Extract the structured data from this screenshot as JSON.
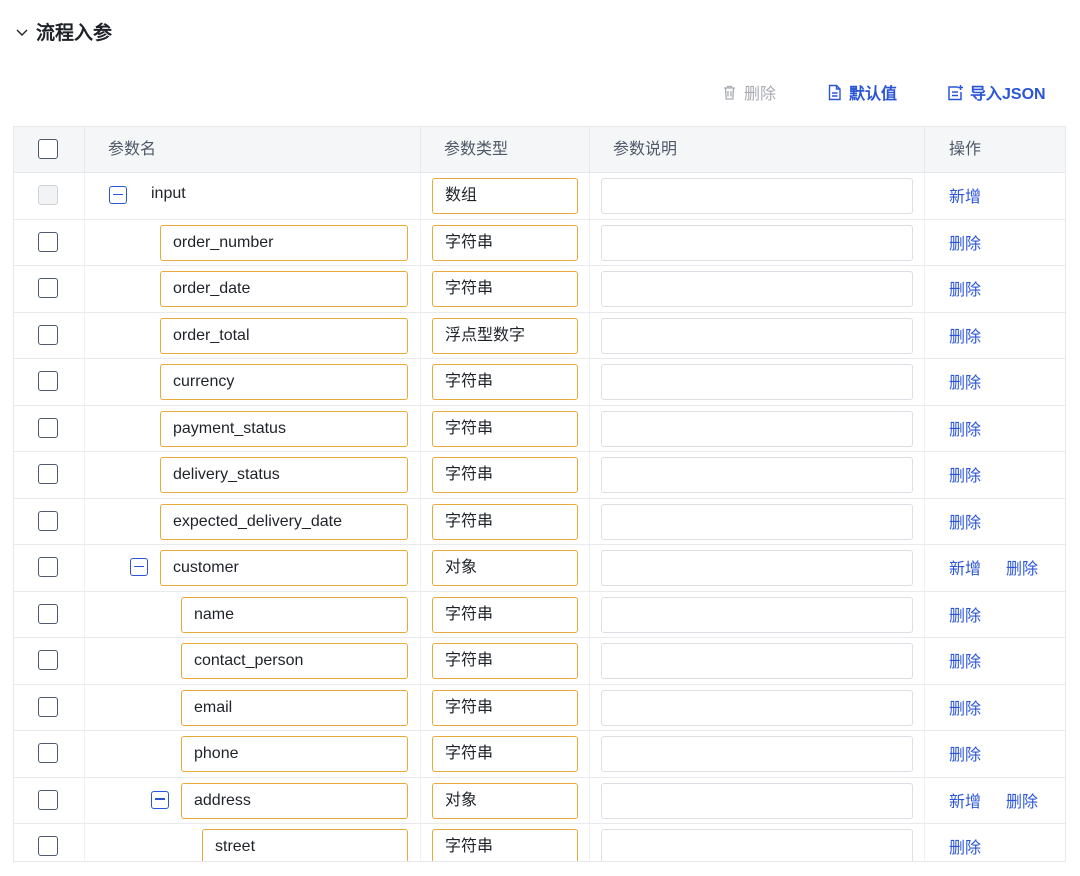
{
  "section": {
    "title": "流程入参"
  },
  "toolbar": {
    "delete_label": "删除",
    "default_label": "默认值",
    "import_label": "导入JSON"
  },
  "columns": {
    "name": "参数名",
    "type": "参数类型",
    "desc": "参数说明",
    "ops": "操作"
  },
  "rows": [
    {
      "name": "input",
      "type": "数组",
      "desc": "",
      "level": 0,
      "collapsible": true,
      "framed": false,
      "disabled": true,
      "actions": [
        "新增"
      ]
    },
    {
      "name": "order_number",
      "type": "字符串",
      "desc": "",
      "level": 1,
      "collapsible": false,
      "framed": true,
      "disabled": false,
      "actions": [
        "删除"
      ]
    },
    {
      "name": "order_date",
      "type": "字符串",
      "desc": "",
      "level": 1,
      "collapsible": false,
      "framed": true,
      "disabled": false,
      "actions": [
        "删除"
      ]
    },
    {
      "name": "order_total",
      "type": "浮点型数字",
      "desc": "",
      "level": 1,
      "collapsible": false,
      "framed": true,
      "disabled": false,
      "actions": [
        "删除"
      ]
    },
    {
      "name": "currency",
      "type": "字符串",
      "desc": "",
      "level": 1,
      "collapsible": false,
      "framed": true,
      "disabled": false,
      "actions": [
        "删除"
      ]
    },
    {
      "name": "payment_status",
      "type": "字符串",
      "desc": "",
      "level": 1,
      "collapsible": false,
      "framed": true,
      "disabled": false,
      "actions": [
        "删除"
      ]
    },
    {
      "name": "delivery_status",
      "type": "字符串",
      "desc": "",
      "level": 1,
      "collapsible": false,
      "framed": true,
      "disabled": false,
      "actions": [
        "删除"
      ]
    },
    {
      "name": "expected_delivery_date",
      "type": "字符串",
      "desc": "",
      "level": 1,
      "collapsible": false,
      "framed": true,
      "disabled": false,
      "actions": [
        "删除"
      ]
    },
    {
      "name": "customer",
      "type": "对象",
      "desc": "",
      "level": 1,
      "collapsible": true,
      "framed": true,
      "disabled": false,
      "actions": [
        "新增",
        "删除"
      ]
    },
    {
      "name": "name",
      "type": "字符串",
      "desc": "",
      "level": 2,
      "collapsible": false,
      "framed": true,
      "disabled": false,
      "actions": [
        "删除"
      ]
    },
    {
      "name": "contact_person",
      "type": "字符串",
      "desc": "",
      "level": 2,
      "collapsible": false,
      "framed": true,
      "disabled": false,
      "actions": [
        "删除"
      ]
    },
    {
      "name": "email",
      "type": "字符串",
      "desc": "",
      "level": 2,
      "collapsible": false,
      "framed": true,
      "disabled": false,
      "actions": [
        "删除"
      ]
    },
    {
      "name": "phone",
      "type": "字符串",
      "desc": "",
      "level": 2,
      "collapsible": false,
      "framed": true,
      "disabled": false,
      "actions": [
        "删除"
      ]
    },
    {
      "name": "address",
      "type": "对象",
      "desc": "",
      "level": 2,
      "collapsible": true,
      "framed": true,
      "disabled": false,
      "actions": [
        "新增",
        "删除"
      ]
    },
    {
      "name": "street",
      "type": "字符串",
      "desc": "",
      "level": 3,
      "collapsible": false,
      "framed": true,
      "disabled": false,
      "actions": [
        "删除"
      ]
    }
  ],
  "colors": {
    "accent": "#2b55d9",
    "field_border": "#e8a93a",
    "muted": "#a8abb2"
  },
  "icons": {
    "collapse": "chevron-down-icon",
    "delete": "trash-icon",
    "default": "document-icon",
    "import": "import-icon",
    "node": "minus-square-icon"
  }
}
